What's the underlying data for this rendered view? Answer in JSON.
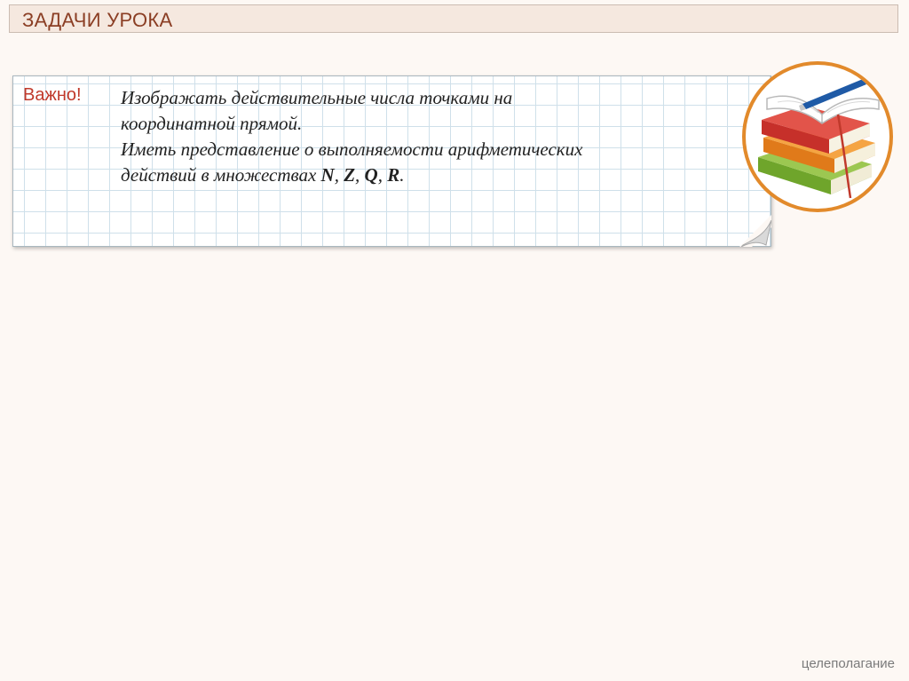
{
  "header": {
    "title": "ЗАДАЧИ УРОКА"
  },
  "note": {
    "label": "Важно!",
    "line1": "Изображать действительные числа точками на",
    "line2": "координатной прямой.",
    "line3": "Иметь представление о выполняемости арифметических",
    "line4_prefix": "действий в множествах ",
    "set_n": "N",
    "sep1": ", ",
    "set_z": "Z",
    "sep2": ", ",
    "set_q": "Q",
    "sep3": ", ",
    "set_r": "R",
    "line4_suffix": "."
  },
  "illustration": {
    "icon": "books-with-pen-icon"
  },
  "footer": {
    "text": "целеполагание"
  },
  "colors": {
    "title_text": "#8b3e24",
    "accent_label": "#c0392b",
    "circle_border": "#e28a2b"
  }
}
